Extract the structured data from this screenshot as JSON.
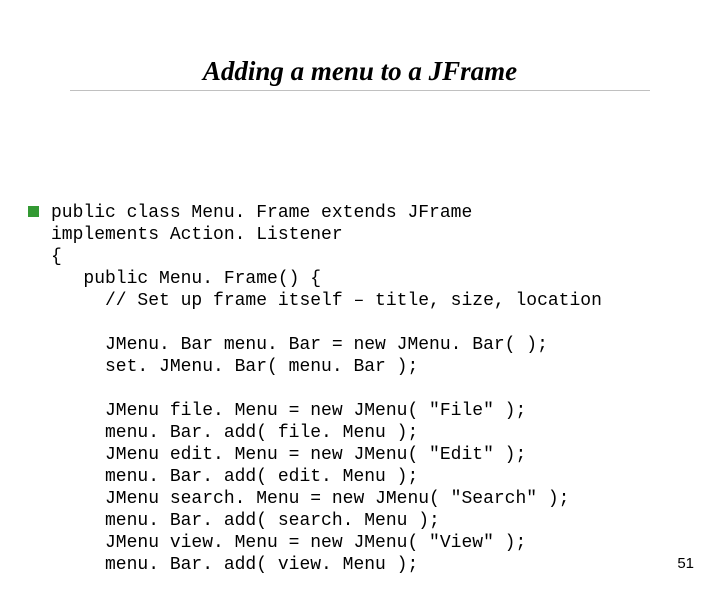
{
  "title": "Adding a menu to a JFrame",
  "code_lines": [
    "public class Menu. Frame extends JFrame",
    "implements Action. Listener",
    "{",
    "   public Menu. Frame() {",
    "     // Set up frame itself – title, size, location",
    "",
    "     JMenu. Bar menu. Bar = new JMenu. Bar( );",
    "     set. JMenu. Bar( menu. Bar );",
    "",
    "     JMenu file. Menu = new JMenu( \"File\" );",
    "     menu. Bar. add( file. Menu );",
    "     JMenu edit. Menu = new JMenu( \"Edit\" );",
    "     menu. Bar. add( edit. Menu );",
    "     JMenu search. Menu = new JMenu( \"Search\" );",
    "     menu. Bar. add( search. Menu );",
    "     JMenu view. Menu = new JMenu( \"View\" );",
    "     menu. Bar. add( view. Menu );"
  ],
  "page_number": "51"
}
